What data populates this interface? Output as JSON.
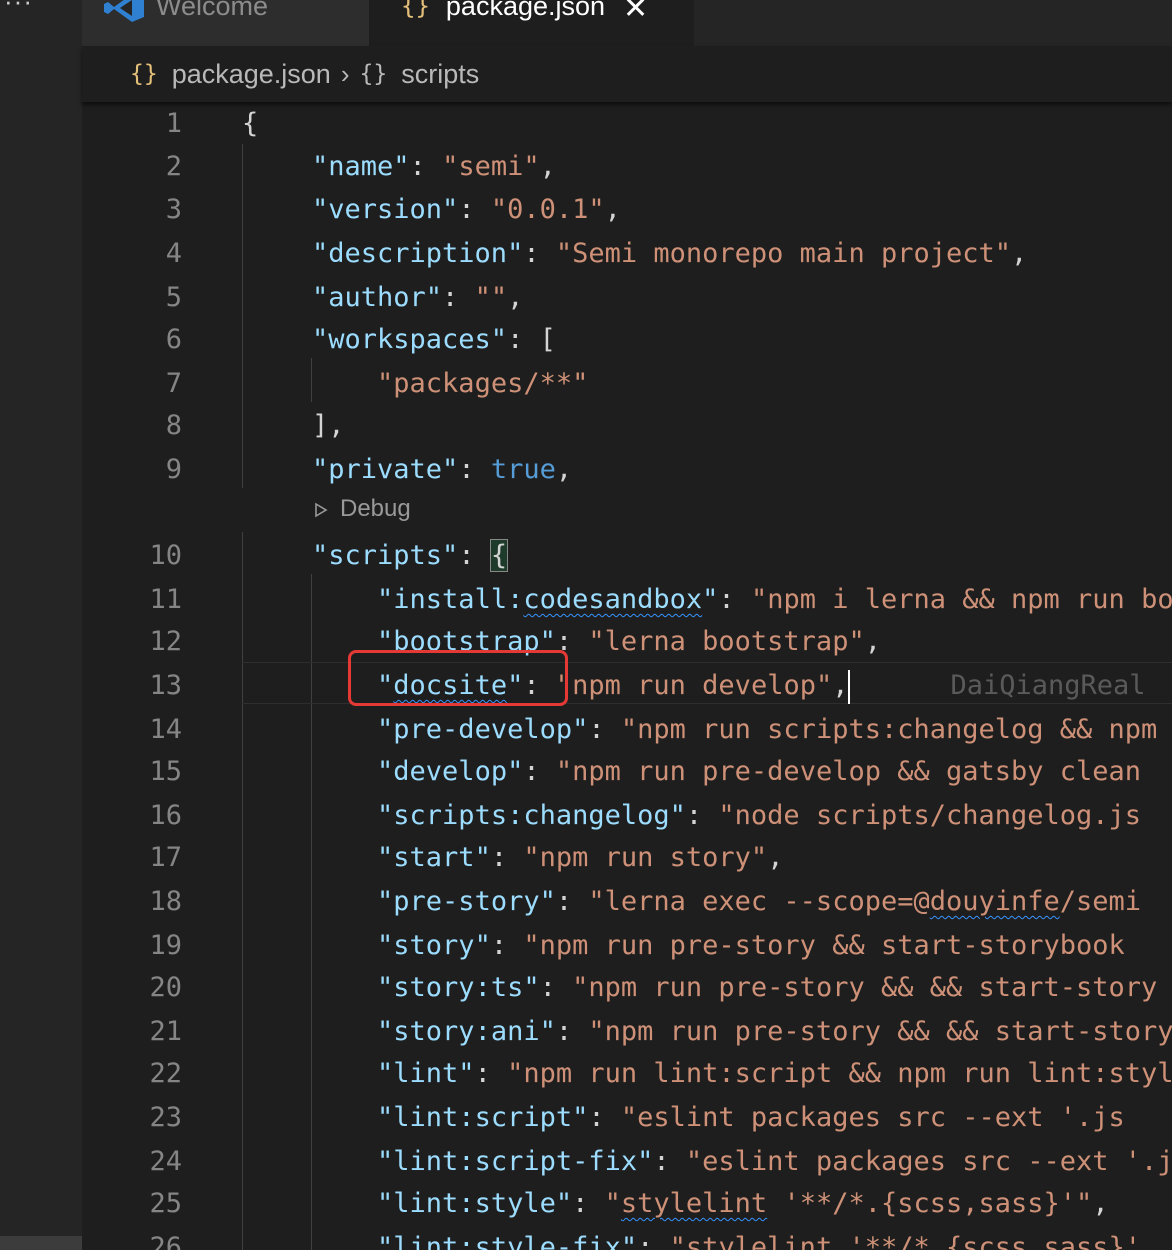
{
  "sidebar": {
    "more_label": "···"
  },
  "tabs": [
    {
      "label": "Welcome",
      "icon": "vscode-logo-icon",
      "active": false
    },
    {
      "label": "package.json",
      "icon": "json-braces-icon",
      "active": true,
      "close": "✕"
    }
  ],
  "breadcrumb": {
    "icon": "{}",
    "file": "package.json",
    "separator": "›",
    "symbol_icon": "{}",
    "symbol": "scripts"
  },
  "codelens": {
    "label": "Debug",
    "icon": "play-outline-icon"
  },
  "editor": {
    "lines": [
      {
        "n": "1",
        "tokens": [
          [
            "p",
            "{"
          ]
        ]
      },
      {
        "n": "2",
        "tokens": [
          [
            "k",
            "\"name\""
          ],
          [
            "p",
            ": "
          ],
          [
            "s",
            "\"semi\""
          ],
          [
            "p",
            ","
          ]
        ]
      },
      {
        "n": "3",
        "tokens": [
          [
            "k",
            "\"version\""
          ],
          [
            "p",
            ": "
          ],
          [
            "s",
            "\"0.0.1\""
          ],
          [
            "p",
            ","
          ]
        ]
      },
      {
        "n": "4",
        "tokens": [
          [
            "k",
            "\"description\""
          ],
          [
            "p",
            ": "
          ],
          [
            "s",
            "\"Semi monorepo main project\""
          ],
          [
            "p",
            ","
          ]
        ]
      },
      {
        "n": "5",
        "tokens": [
          [
            "k",
            "\"author\""
          ],
          [
            "p",
            ": "
          ],
          [
            "s",
            "\"\""
          ],
          [
            "p",
            ","
          ]
        ]
      },
      {
        "n": "6",
        "tokens": [
          [
            "k",
            "\"workspaces\""
          ],
          [
            "p",
            ": ["
          ]
        ]
      },
      {
        "n": "7",
        "tokens": [
          [
            "p",
            "    "
          ],
          [
            "s",
            "\"packages/**\""
          ]
        ]
      },
      {
        "n": "8",
        "tokens": [
          [
            "p",
            "],"
          ]
        ]
      },
      {
        "n": "9",
        "tokens": [
          [
            "k",
            "\"private\""
          ],
          [
            "p",
            ": "
          ],
          [
            "b",
            "true"
          ],
          [
            "p",
            ","
          ]
        ]
      },
      {
        "n": "10",
        "tokens": [
          [
            "k",
            "\"scripts\""
          ],
          [
            "p",
            ": "
          ],
          [
            "pb",
            "{"
          ]
        ]
      },
      {
        "n": "11",
        "tokens": [
          [
            "p",
            "    "
          ],
          [
            "k",
            "\"install:"
          ],
          [
            "kq",
            "codesandbox"
          ],
          [
            "k",
            "\""
          ],
          [
            "p",
            ": "
          ],
          [
            "s",
            "\"npm i lerna && npm run bootstrap\""
          ]
        ]
      },
      {
        "n": "12",
        "tokens": [
          [
            "p",
            "    "
          ],
          [
            "k",
            "\"bootstrap\""
          ],
          [
            "p",
            ": "
          ],
          [
            "s",
            "\"lerna bootstrap\""
          ],
          [
            "p",
            ","
          ]
        ]
      },
      {
        "n": "13",
        "tokens": [
          [
            "p",
            "    "
          ],
          [
            "k",
            "\""
          ],
          [
            "kq",
            "docsite"
          ],
          [
            "k",
            "\""
          ],
          [
            "p",
            ": "
          ],
          [
            "s",
            "\"npm run develop\""
          ],
          [
            "p",
            ","
          ],
          [
            "cur",
            ""
          ],
          [
            "ghost",
            "DaiQiangReal"
          ]
        ]
      },
      {
        "n": "14",
        "tokens": [
          [
            "p",
            "    "
          ],
          [
            "k",
            "\"pre-develop\""
          ],
          [
            "p",
            ": "
          ],
          [
            "s",
            "\"npm run scripts:changelog && npm run"
          ]
        ]
      },
      {
        "n": "15",
        "tokens": [
          [
            "p",
            "    "
          ],
          [
            "k",
            "\"develop\""
          ],
          [
            "p",
            ": "
          ],
          [
            "s",
            "\"npm run pre-develop && gatsby clean"
          ]
        ]
      },
      {
        "n": "16",
        "tokens": [
          [
            "p",
            "    "
          ],
          [
            "k",
            "\"scripts:changelog\""
          ],
          [
            "p",
            ": "
          ],
          [
            "s",
            "\"node scripts/changelog.js"
          ]
        ]
      },
      {
        "n": "17",
        "tokens": [
          [
            "p",
            "    "
          ],
          [
            "k",
            "\"start\""
          ],
          [
            "p",
            ": "
          ],
          [
            "s",
            "\"npm run story\""
          ],
          [
            "p",
            ","
          ]
        ]
      },
      {
        "n": "18",
        "tokens": [
          [
            "p",
            "    "
          ],
          [
            "k",
            "\"pre-story\""
          ],
          [
            "p",
            ": "
          ],
          [
            "s",
            "\"lerna exec --scope=@"
          ],
          [
            "sq",
            "douyinfe"
          ],
          [
            "s",
            "/semi"
          ]
        ]
      },
      {
        "n": "19",
        "tokens": [
          [
            "p",
            "    "
          ],
          [
            "k",
            "\"story\""
          ],
          [
            "p",
            ": "
          ],
          [
            "s",
            "\"npm run pre-story && start-storybook"
          ]
        ]
      },
      {
        "n": "20",
        "tokens": [
          [
            "p",
            "    "
          ],
          [
            "k",
            "\"story:ts\""
          ],
          [
            "p",
            ": "
          ],
          [
            "s",
            "\"npm run pre-story && && start-story"
          ]
        ]
      },
      {
        "n": "21",
        "tokens": [
          [
            "p",
            "    "
          ],
          [
            "k",
            "\"story:ani\""
          ],
          [
            "p",
            ": "
          ],
          [
            "s",
            "\"npm run pre-story && && start-story"
          ]
        ]
      },
      {
        "n": "22",
        "tokens": [
          [
            "p",
            "    "
          ],
          [
            "k",
            "\"lint\""
          ],
          [
            "p",
            ": "
          ],
          [
            "s",
            "\"npm run lint:script && npm run lint:style"
          ]
        ]
      },
      {
        "n": "23",
        "tokens": [
          [
            "p",
            "    "
          ],
          [
            "k",
            "\"lint:script\""
          ],
          [
            "p",
            ": "
          ],
          [
            "s",
            "\"eslint packages src --ext '.js"
          ]
        ]
      },
      {
        "n": "24",
        "tokens": [
          [
            "p",
            "    "
          ],
          [
            "k",
            "\"lint:script-fix\""
          ],
          [
            "p",
            ": "
          ],
          [
            "s",
            "\"eslint packages src --ext '.js"
          ]
        ]
      },
      {
        "n": "25",
        "tokens": [
          [
            "p",
            "    "
          ],
          [
            "k",
            "\"lint:style\""
          ],
          [
            "p",
            ": "
          ],
          [
            "s",
            "\""
          ],
          [
            "sq",
            "stylelint"
          ],
          [
            "s",
            " '**/*.{scss,sass}'\""
          ],
          [
            "p",
            ","
          ]
        ]
      },
      {
        "n": "26",
        "tokens": [
          [
            "p",
            "    "
          ],
          [
            "k",
            "\"lint:style-fix\""
          ],
          [
            "p",
            ": "
          ],
          [
            "s",
            "\"stylelint '**/*.{scss,sass}'"
          ]
        ]
      }
    ]
  },
  "colors": {
    "key": "#9cdcfe",
    "string": "#ce9178",
    "boolean": "#569cd6",
    "highlight_box": "#e53935"
  }
}
